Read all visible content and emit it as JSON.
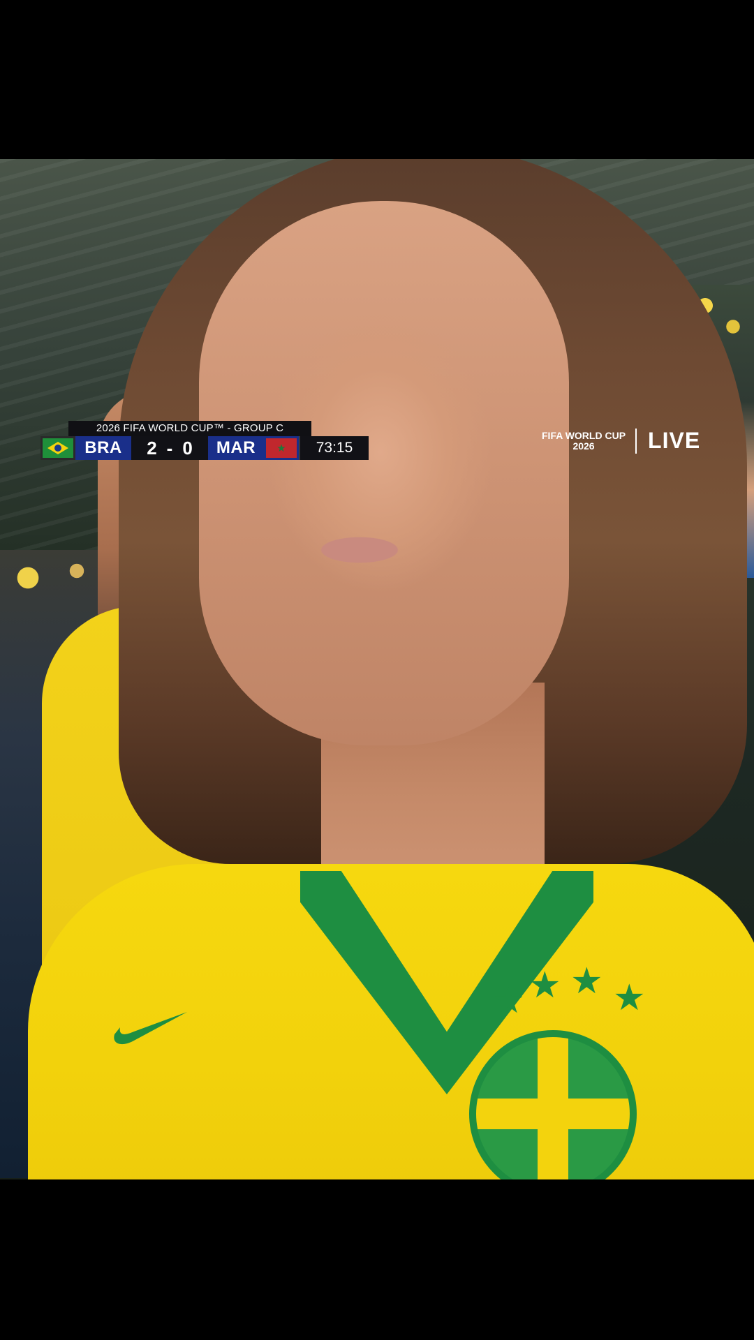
{
  "scoreboard": {
    "competition": "2026 FIFA WORLD CUP™ - GROUP C",
    "home_team": "BRA",
    "home_score": "2",
    "separator": "-",
    "away_score": "0",
    "away_team": "MAR",
    "match_clock": "73:15",
    "home_flag_icon": "brazil-flag-icon",
    "away_flag_icon": "morocco-flag-icon"
  },
  "broadcast_bug": {
    "event_line1": "FIFA WORLD CUP",
    "event_line2": "2026",
    "live_label": "LIVE"
  },
  "colors": {
    "team_bar": "#1a2f8a",
    "score_bar": "#111116",
    "jersey_yellow": "#f2d20c",
    "jersey_green": "#1e8e41"
  }
}
